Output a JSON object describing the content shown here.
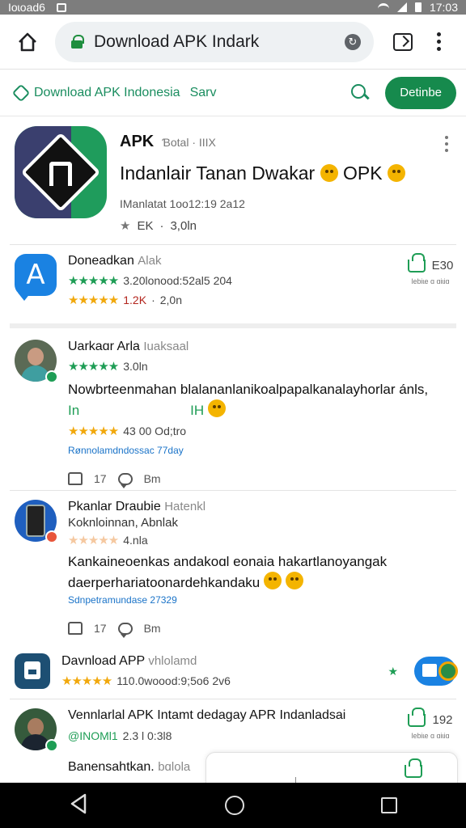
{
  "status_bar": {
    "left_text": "Ioɩoad6",
    "time": "17:03"
  },
  "browser": {
    "url_text": "Download APK Indark"
  },
  "site": {
    "title": "Download APK Indonesia",
    "sub_label": "Sarv",
    "header_button": "Detinbe"
  },
  "hero": {
    "brand": "APK",
    "brand_sub": "Ɓotal · IIIX",
    "title": "Indanlair Tanan Dwakar",
    "title_suffix": "OPK",
    "meta": "IManlatat 1oo12:19 2a12",
    "rating_label": "EK",
    "size": "3,0ln"
  },
  "app_row": {
    "icon_letter": "A",
    "title": "Doneadkan",
    "title_sub": "Alak",
    "line1_stars": "★★★★★",
    "line1_text": "3.20lonood:52al5 204",
    "line2_stars": "★★★★★",
    "line2_count": "1.2K",
    "line2_size": "2,0n",
    "side_count": "E30",
    "side_tiny": "Ɩebiɩe ɑ ɑiɩiɑ"
  },
  "review1": {
    "name": "Uarkaɑr Arla",
    "name_sub": "Iuaksaal",
    "stars": "★★★★★",
    "stars_text": "3.0ln",
    "text": "Nowbrteenmahan blalananlanikoalpapalkanalayhorlar ánls,",
    "text2_a": "In",
    "text2_b": "IH",
    "rating_stars": "★★★★★",
    "rating_text": "43 00 Od;tro",
    "link": "Rønnolamdndossac 77day",
    "likes": "17",
    "reply_label": "Bm"
  },
  "review2": {
    "name": "Pkanlar Draubie",
    "name_sub": "Hatenkl",
    "subtitle": "Koknloinnan, Abnlak",
    "stars": "★★★★★",
    "stars_text": "4.nla",
    "text": "Kankaineoenkas andakoɑl eonaia hakartlanoyangak",
    "text2": "daerperhariatoonardehkandaku",
    "link": "Sdnpetramundase 27329",
    "likes": "17",
    "reply_label": "Bm"
  },
  "download_row": {
    "title": "Davnload APP",
    "title_sub": "vhlolamd",
    "stars": "★★★★★",
    "text": "110.0woood:9;5o6 2v6"
  },
  "review3": {
    "name": "Vennlarlal APK Intamt dedagay APR Indanladsai",
    "handle": "@INOMl1",
    "handle_text": "2.3 l 0:3l8",
    "side_count": "192",
    "side_tiny": "Ɩebiɩe ɑ ɑiɩiɑ"
  },
  "last_row": {
    "title": "Banensahtkan.",
    "title_sub": "bɑlola"
  },
  "colors": {
    "brand_green": "#168a4d",
    "link_blue": "#1a73c8",
    "star_gold": "#f1a80c"
  }
}
